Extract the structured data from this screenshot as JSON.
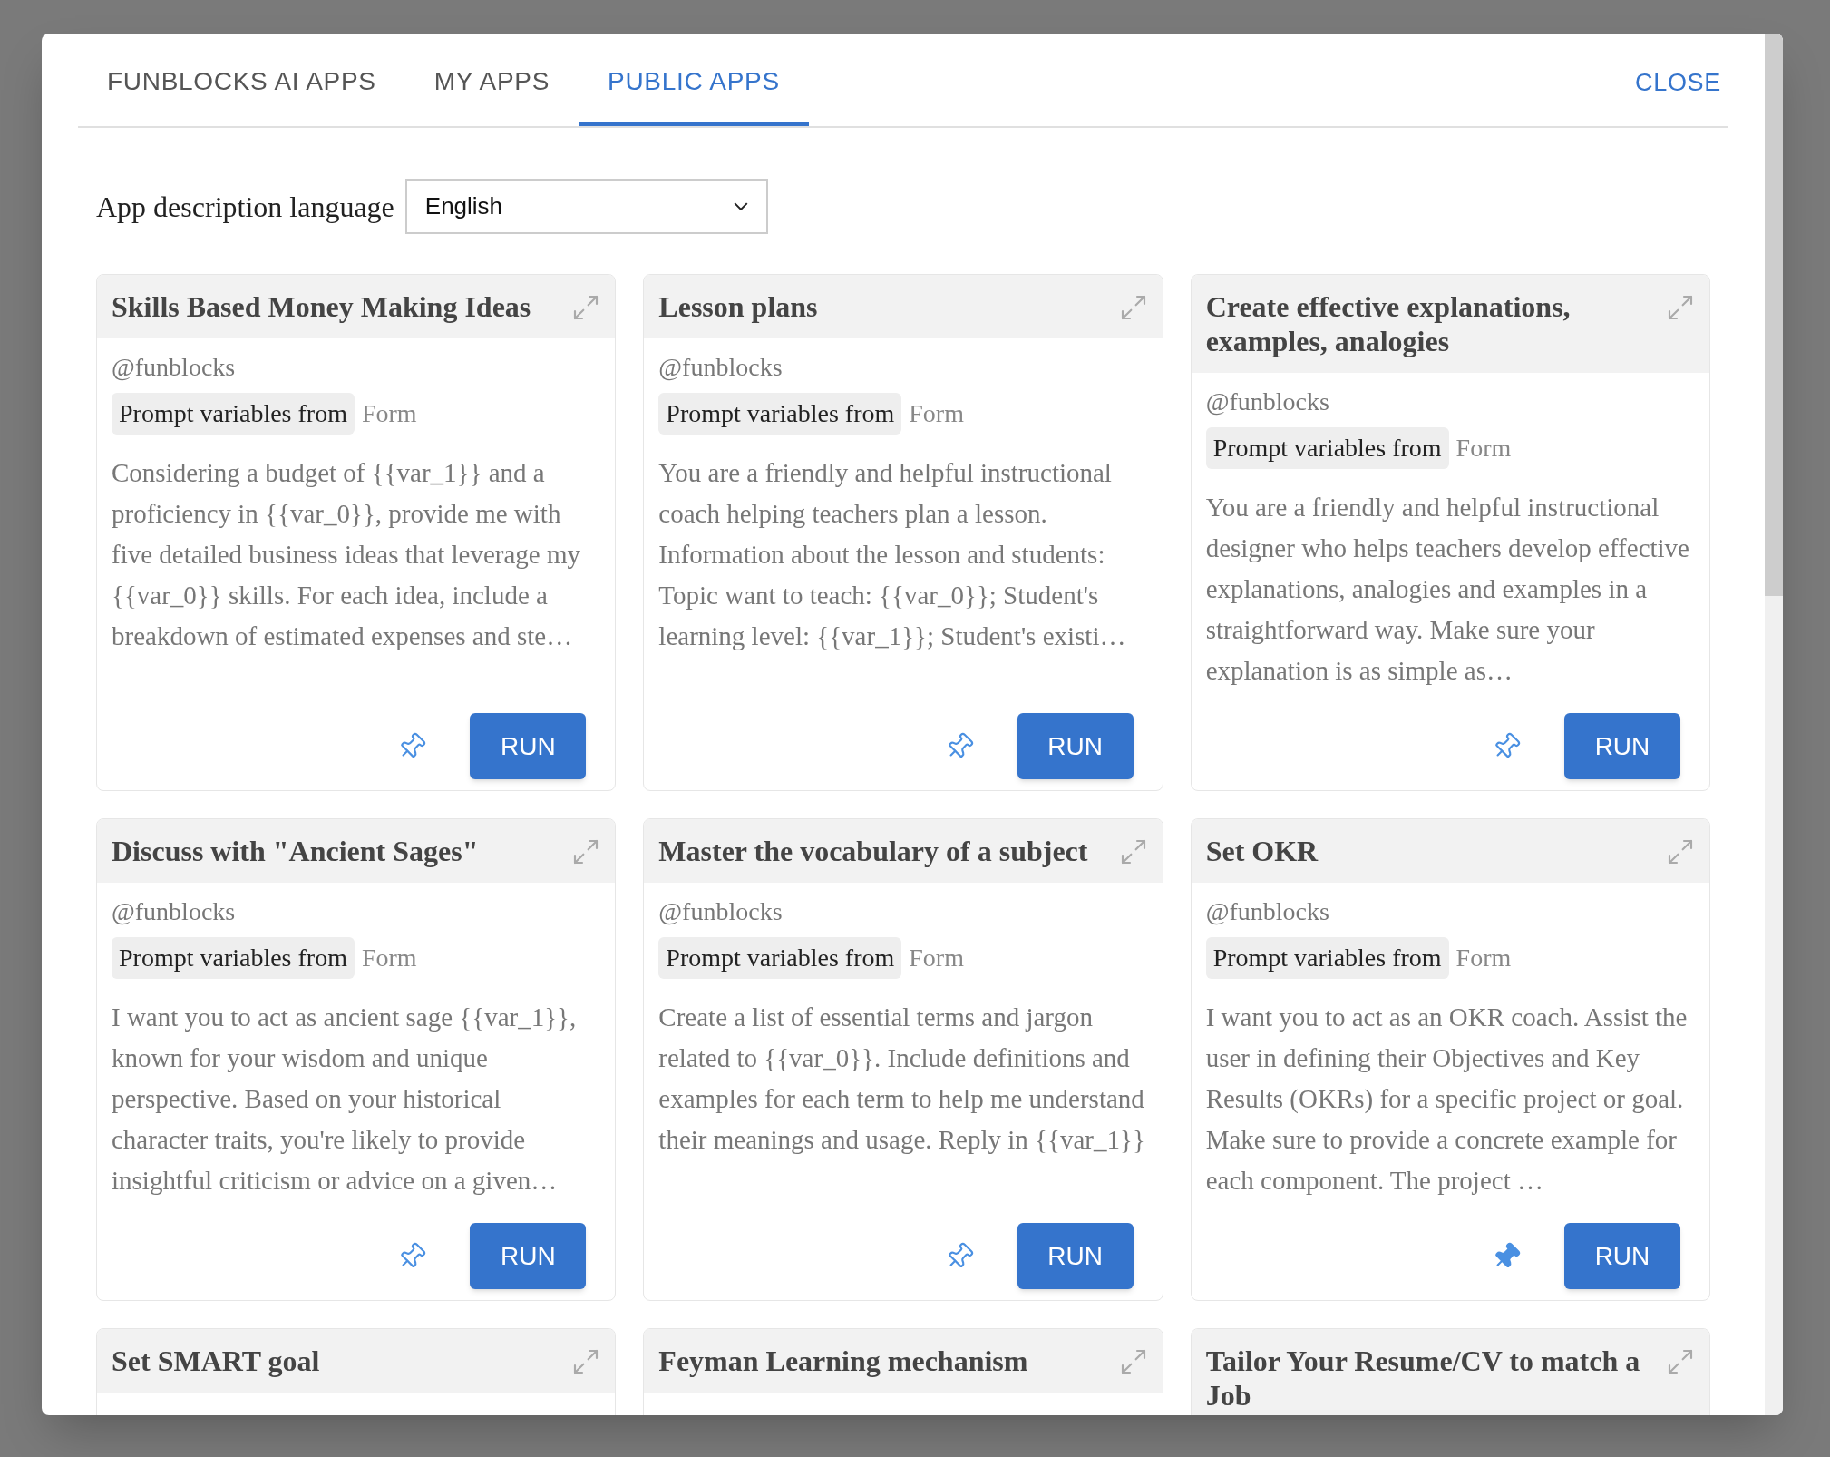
{
  "tabs": [
    {
      "label": "FUNBLOCKS AI APPS",
      "selected": false
    },
    {
      "label": "MY APPS",
      "selected": false
    },
    {
      "label": "PUBLIC APPS",
      "selected": true
    }
  ],
  "close_button": "CLOSE",
  "language": {
    "label": "App description language",
    "value": "English"
  },
  "apps": [
    {
      "title": "Skills Based Money Making Ideas",
      "author": "@funblocks",
      "variables_label": "Prompt variables from",
      "variables_source": "Form",
      "description": "Considering a budget of {{var_1}} and a proficiency in {{var_0}}, provide me with five detailed business ideas that leverage my {{var_0}} skills. For each idea, include a breakdown of estimated expenses and ste…",
      "pinned": false,
      "run": "RUN"
    },
    {
      "title": "Lesson plans",
      "author": "@funblocks",
      "variables_label": "Prompt variables from",
      "variables_source": "Form",
      "description": "You are a friendly and helpful instructional coach helping teachers plan a lesson. Information about the lesson and students: Topic want to teach: {{var_0}}; Student's learning level: {{var_1}}; Student's existi…",
      "pinned": false,
      "run": "RUN"
    },
    {
      "title": "Create effective explanations, examples, analogies",
      "author": "@funblocks",
      "variables_label": "Prompt variables from",
      "variables_source": "Form",
      "description": "You are a friendly and helpful instructional designer who helps teachers develop effective explanations, analogies and examples in a straightforward way. Make sure your explanation is as simple as…",
      "pinned": false,
      "run": "RUN"
    },
    {
      "title": "Discuss with \"Ancient Sages\"",
      "author": "@funblocks",
      "variables_label": "Prompt variables from",
      "variables_source": "Form",
      "description": "I want you to act as ancient sage {{var_1}}, known for your wisdom and unique perspective. Based on your historical character traits, you're likely to provide insightful criticism or advice on a given…",
      "pinned": false,
      "run": "RUN"
    },
    {
      "title": "Master the vocabulary of a subject",
      "author": "@funblocks",
      "variables_label": "Prompt variables from",
      "variables_source": "Form",
      "description": "Create a list of essential terms and jargon related to {{var_0}}. Include definitions and examples for each term to help me understand their meanings and usage. Reply in {{var_1}}",
      "pinned": false,
      "run": "RUN"
    },
    {
      "title": "Set OKR",
      "author": "@funblocks",
      "variables_label": "Prompt variables from",
      "variables_source": "Form",
      "description": "I want you to act as an OKR coach. Assist the user in defining their Objectives and Key Results (OKRs) for a specific project or goal. Make sure to provide a concrete example for each component. The project …",
      "pinned": true,
      "run": "RUN"
    },
    {
      "title": "Set SMART goal"
    },
    {
      "title": "Feyman Learning mechanism"
    },
    {
      "title": "Tailor Your Resume/CV to match a Job"
    }
  ]
}
